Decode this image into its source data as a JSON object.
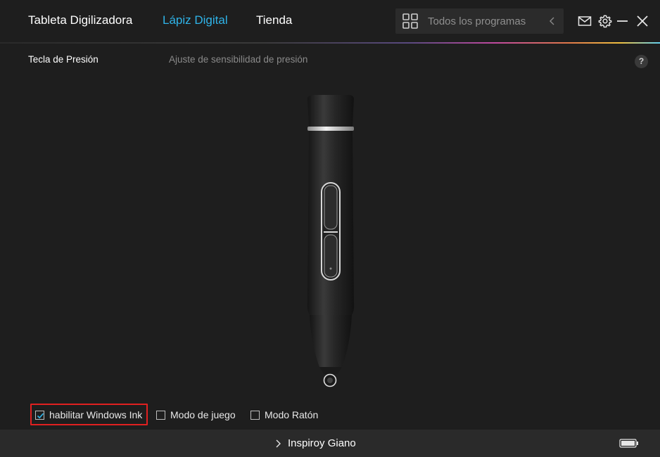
{
  "nav": {
    "tabs": [
      {
        "label": "Tableta Digilizadora",
        "active": false
      },
      {
        "label": "Lápiz Digital",
        "active": true
      },
      {
        "label": "Tienda",
        "active": false
      }
    ]
  },
  "program_selector": {
    "value": "Todos los programas",
    "icon": "grid-icon"
  },
  "window_controls": [
    "mail-icon",
    "gear-icon",
    "minimize-icon",
    "close-icon"
  ],
  "subtabs": [
    {
      "label": "Tecla de Presión",
      "active": true
    },
    {
      "label": "Ajuste de sensibilidad de presión",
      "active": false
    }
  ],
  "help": {
    "label": "?"
  },
  "options": [
    {
      "label": "habilitar Windows Ink",
      "checked": true,
      "highlighted": true
    },
    {
      "label": "Modo de juego",
      "checked": false
    },
    {
      "label": "Modo Ratón",
      "checked": false
    }
  ],
  "status": {
    "device_name": "Inspiroy Giano",
    "battery": "battery-icon"
  },
  "colors": {
    "accent": "#2fb4e9",
    "highlight": "#e02020",
    "background": "#1e1e1e",
    "statusbar": "#2a2a2a"
  }
}
